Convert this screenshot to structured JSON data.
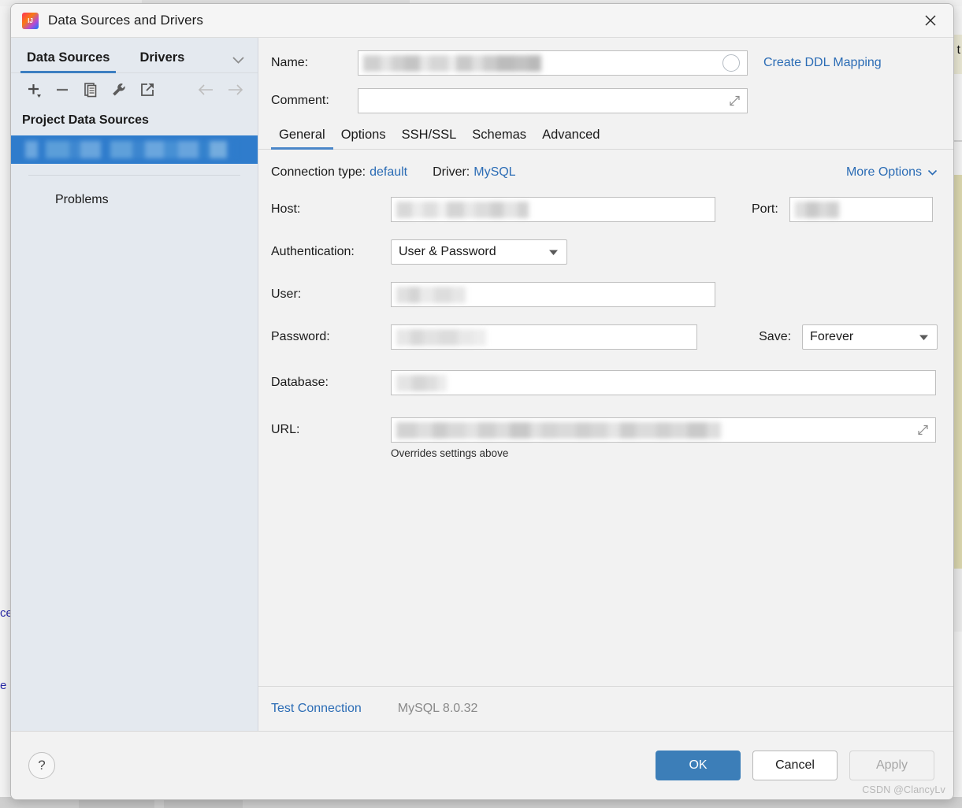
{
  "window": {
    "title": "Data Sources and Drivers",
    "logo_icon": "intellij-idea-logo-icon",
    "close_icon": "close-icon"
  },
  "sidebar": {
    "tabs": [
      {
        "label": "Data Sources",
        "active": true
      },
      {
        "label": "Drivers",
        "active": false
      }
    ],
    "tabs_chevron_icon": "chevron-down-icon",
    "toolbar": [
      {
        "name": "add-data-source-button",
        "icon": "plus-icon",
        "enabled": true
      },
      {
        "name": "remove-data-source-button",
        "icon": "minus-icon",
        "enabled": true
      },
      {
        "name": "duplicate-data-source-button",
        "icon": "copy-icon",
        "enabled": true
      },
      {
        "name": "properties-button",
        "icon": "wrench-icon",
        "enabled": true
      },
      {
        "name": "export-button",
        "icon": "external-link-icon",
        "enabled": true
      },
      {
        "name": "navigate-back-button",
        "icon": "arrow-left-icon",
        "enabled": false
      },
      {
        "name": "navigate-forward-button",
        "icon": "arrow-right-icon",
        "enabled": false
      }
    ],
    "section_title": "Project Data Sources",
    "selected_item": {
      "label": "",
      "redacted": true
    },
    "items": [
      {
        "label": "Problems"
      }
    ]
  },
  "main": {
    "name": {
      "label": "Name:",
      "value": "",
      "redacted": true,
      "status_icon": "circle-icon"
    },
    "create_ddl_mapping_link": "Create DDL Mapping",
    "comment": {
      "label": "Comment:",
      "value": "",
      "expand_icon": "expand-icon"
    },
    "tabs": [
      {
        "label": "General",
        "active": true
      },
      {
        "label": "Options",
        "active": false
      },
      {
        "label": "SSH/SSL",
        "active": false
      },
      {
        "label": "Schemas",
        "active": false
      },
      {
        "label": "Advanced",
        "active": false
      }
    ],
    "connection_type": {
      "label": "Connection type:",
      "value": "default"
    },
    "driver": {
      "label": "Driver:",
      "value": "MySQL"
    },
    "more_options": {
      "label": "More Options",
      "icon": "chevron-down-icon"
    },
    "host": {
      "label": "Host:",
      "value": "",
      "redacted": true
    },
    "port": {
      "label": "Port:",
      "value": "",
      "redacted": true
    },
    "authentication": {
      "label": "Authentication:",
      "value": "User & Password",
      "caret_icon": "caret-down-icon"
    },
    "user": {
      "label": "User:",
      "value": "",
      "redacted": true
    },
    "password": {
      "label": "Password:",
      "value": "",
      "redacted": true
    },
    "save": {
      "label": "Save:",
      "value": "Forever",
      "caret_icon": "caret-down-icon"
    },
    "database": {
      "label": "Database:",
      "value": "",
      "redacted": true
    },
    "url": {
      "label": "URL:",
      "value": "",
      "redacted": true,
      "expand_icon": "expand-icon",
      "note": "Overrides settings above"
    },
    "test_connection_link": "Test Connection",
    "driver_version": "MySQL 8.0.32"
  },
  "footer": {
    "help_icon": "question-mark-icon",
    "ok_label": "OK",
    "cancel_label": "Cancel",
    "apply_label": "Apply"
  },
  "watermark": "CSDN @ClancyLv",
  "colors": {
    "accent_blue": "#3c7eb8",
    "link_blue": "#2b6cb5",
    "selection_blue": "#2f7ccc",
    "sidebar_bg": "#e4e9ef",
    "panel_bg": "#f2f2f2",
    "titlebar_bg": "#f5f5f5"
  },
  "background_app": {
    "left_fragments": [
      "ce",
      "e"
    ],
    "right_fragment": "t"
  }
}
